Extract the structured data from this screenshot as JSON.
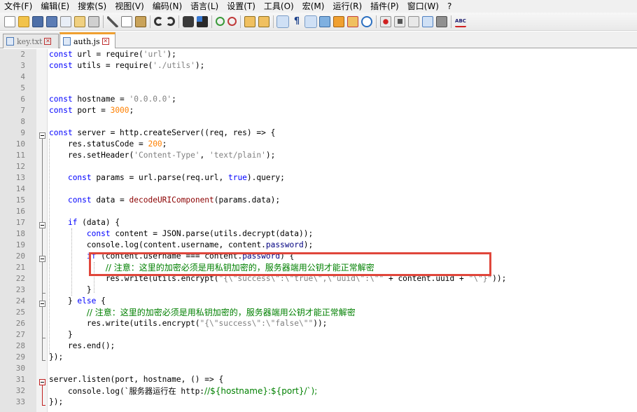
{
  "menu": [
    "文件(F)",
    "编辑(E)",
    "搜索(S)",
    "视图(V)",
    "编码(N)",
    "语言(L)",
    "设置(T)",
    "工具(O)",
    "宏(M)",
    "运行(R)",
    "插件(P)",
    "窗口(W)",
    "?"
  ],
  "tabs": [
    {
      "label": "key.txt",
      "active": false
    },
    {
      "label": "auth.js",
      "active": true
    }
  ],
  "colors": {
    "keyword": "#0000ff",
    "function": "#8b0000",
    "string": "#808080",
    "number": "#ff8000",
    "comment": "#008000",
    "annotation_box": "#e0463b",
    "active_tab_marker": "#f0a030"
  },
  "toolbar_icons": [
    "new-file-icon",
    "open-file-icon",
    "save-icon",
    "save-all-icon",
    "close-icon",
    "close-all-icon",
    "print-icon",
    "cut-icon",
    "copy-icon",
    "paste-icon",
    "undo-icon",
    "redo-icon",
    "find-icon",
    "replace-icon",
    "zoom-in-icon",
    "zoom-out-icon",
    "sync-vertical-icon",
    "sync-horizontal-icon",
    "word-wrap-icon",
    "show-all-chars-icon",
    "indent-guide-icon",
    "doc-map-icon",
    "function-list-icon",
    "folder-workspace-icon",
    "monitoring-icon",
    "record-macro-icon",
    "stop-record-icon",
    "play-macro-icon",
    "run-macro-multiple-icon",
    "save-macro-icon",
    "spell-check-icon"
  ],
  "editor": {
    "lines": [
      {
        "n": "2",
        "text": "const url = require('url');"
      },
      {
        "n": "3",
        "text": "const utils = require('./utils');"
      },
      {
        "n": "4",
        "text": ""
      },
      {
        "n": "5",
        "text": ""
      },
      {
        "n": "6",
        "text": "const hostname = '0.0.0.0';"
      },
      {
        "n": "7",
        "text": "const port = 3000;"
      },
      {
        "n": "8",
        "text": ""
      },
      {
        "n": "9",
        "text": "const server = http.createServer((req, res) => {"
      },
      {
        "n": "10",
        "text": "    res.statusCode = 200;"
      },
      {
        "n": "11",
        "text": "    res.setHeader('Content-Type', 'text/plain');"
      },
      {
        "n": "12",
        "text": ""
      },
      {
        "n": "13",
        "text": "    const params = url.parse(req.url, true).query;"
      },
      {
        "n": "14",
        "text": ""
      },
      {
        "n": "15",
        "text": "    const data = decodeURIComponent(params.data);"
      },
      {
        "n": "16",
        "text": ""
      },
      {
        "n": "17",
        "text": "    if (data) {"
      },
      {
        "n": "18",
        "text": "        const content = JSON.parse(utils.decrypt(data));"
      },
      {
        "n": "19",
        "text": "        console.log(content.username, content.password);"
      },
      {
        "n": "20",
        "text": "        if (content.username === content.password) {"
      },
      {
        "n": "21",
        "text": "            // 注意：这里的加密必须是用私钥加密的，服务器端用公钥才能正常解密"
      },
      {
        "n": "22",
        "text": "            res.write(utils.encrypt(\"{\\\"success\\\":\\\"true\\\",\\\"uuid\\\":\\\"\" + content.uuid + \"\\\"}\"));"
      },
      {
        "n": "23",
        "text": "        }"
      },
      {
        "n": "24",
        "text": "    } else {"
      },
      {
        "n": "25",
        "text": "        // 注意：这里的加密必须是用私钥加密的，服务器端用公钥才能正常解密"
      },
      {
        "n": "26",
        "text": "        res.write(utils.encrypt(\"{\\\"success\\\":\\\"false\\\"\"));"
      },
      {
        "n": "27",
        "text": "    }"
      },
      {
        "n": "28",
        "text": "    res.end();"
      },
      {
        "n": "29",
        "text": "});"
      },
      {
        "n": "30",
        "text": ""
      },
      {
        "n": "31",
        "text": "server.listen(port, hostname, () => {"
      },
      {
        "n": "32",
        "text": "    console.log(`服务器运行在 http://${hostname}:${port}/`);"
      },
      {
        "n": "33",
        "text": "});"
      }
    ]
  }
}
